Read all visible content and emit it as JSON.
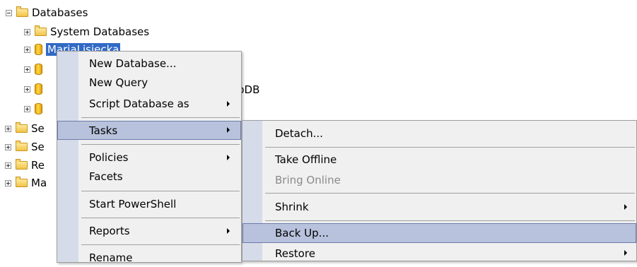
{
  "tree": {
    "databases": "Databases",
    "system_databases": "System Databases",
    "selected_db": "MariaLisiecka",
    "partial_db_suffix": "pDB",
    "partial_rows": [
      "Se",
      "Se",
      "Re",
      "Ma"
    ]
  },
  "context_menu": {
    "new_database": "New Database...",
    "new_query": "New Query",
    "script_database_as": "Script Database as",
    "tasks": "Tasks",
    "policies": "Policies",
    "facets": "Facets",
    "start_powershell": "Start PowerShell",
    "reports": "Reports",
    "rename": "Rename"
  },
  "tasks_menu": {
    "detach": "Detach...",
    "take_offline": "Take Offline",
    "bring_online": "Bring Online",
    "shrink": "Shrink",
    "back_up": "Back Up...",
    "restore": "Restore"
  },
  "colors": {
    "selection": "#316ac5",
    "menu_highlight": "#b8c2dc",
    "menu_gutter": "#d6dbe9",
    "menu_background": "#f0f0f0"
  },
  "icons": [
    "expand-icon",
    "collapse-icon",
    "folder-icon",
    "database-icon",
    "submenu-arrow-icon"
  ]
}
